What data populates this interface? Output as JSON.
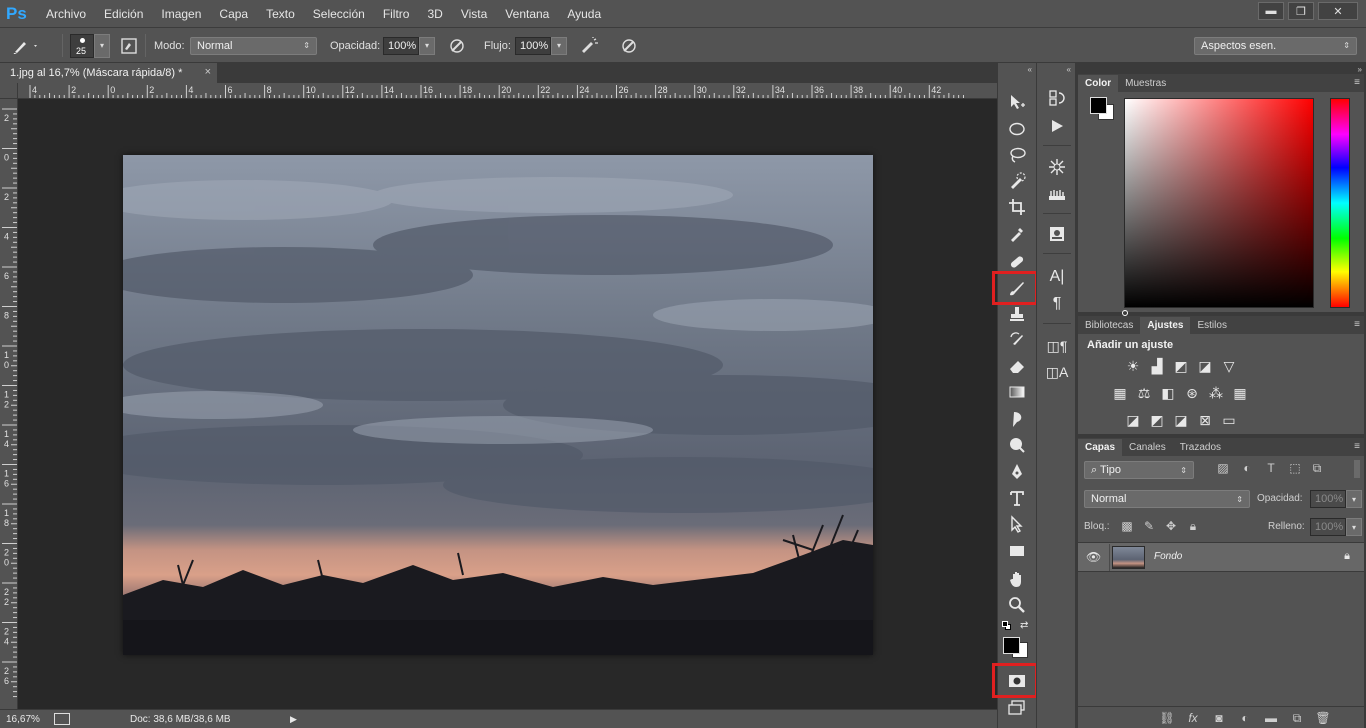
{
  "app": {
    "logo": "Ps"
  },
  "menu": [
    "Archivo",
    "Edición",
    "Imagen",
    "Capa",
    "Texto",
    "Selección",
    "Filtro",
    "3D",
    "Vista",
    "Ventana",
    "Ayuda"
  ],
  "window_controls": {
    "minimize": "▬",
    "restore": "❐",
    "close": "✕"
  },
  "options": {
    "brush_size": "25",
    "mode_label": "Modo:",
    "mode_value": "Normal",
    "opacity_label": "Opacidad:",
    "opacity_value": "100%",
    "flow_label": "Flujo:",
    "flow_value": "100%",
    "workspace": "Aspectos esen."
  },
  "document": {
    "tab_title": "1.jpg al 16,7% (Máscara rápida/8) *",
    "close": "×"
  },
  "ruler_top_labels": [
    "4",
    "2",
    "0",
    "2",
    "4",
    "6",
    "8",
    "10",
    "12",
    "14",
    "16",
    "18",
    "20",
    "22",
    "24",
    "26",
    "28",
    "30",
    "32",
    "34",
    "36",
    "38",
    "40",
    "42"
  ],
  "ruler_left_labels": [
    "2",
    "0",
    "2",
    "4",
    "6",
    "8",
    "10",
    "12",
    "14",
    "16",
    "18",
    "20",
    "22",
    "24",
    "26"
  ],
  "status": {
    "zoom": "16,67%",
    "doc": "Doc: 38,6 MB/38,6 MB"
  },
  "panels": {
    "color_tabs": [
      "Color",
      "Muestras"
    ],
    "adjust_tabs": [
      "Bibliotecas",
      "Ajustes",
      "Estilos"
    ],
    "adjust_title": "Añadir un ajuste",
    "layers_tabs": [
      "Capas",
      "Canales",
      "Trazados"
    ],
    "layers_kind": "Tipo",
    "blend_mode": "Normal",
    "opacity_label": "Opacidad:",
    "opacity_value": "100%",
    "lock_label": "Bloq.:",
    "fill_label": "Relleno:",
    "fill_value": "100%",
    "layer_name": "Fondo"
  },
  "colors": {
    "highlight": "#e02020",
    "foreground": "#000000",
    "background": "#ffffff"
  }
}
